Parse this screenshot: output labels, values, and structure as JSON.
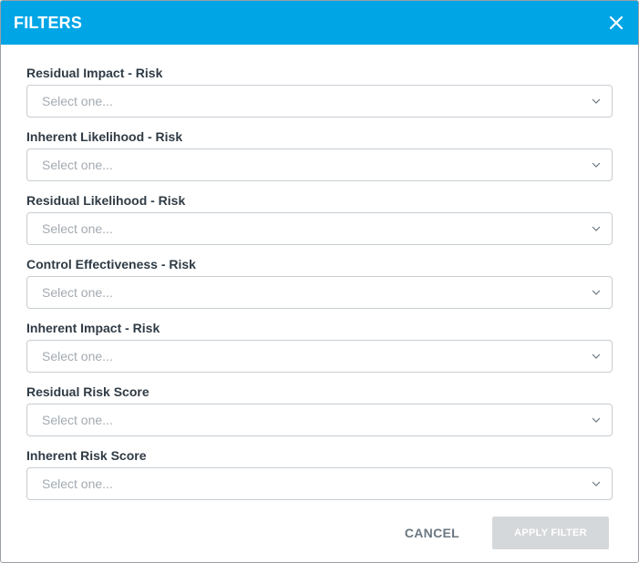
{
  "dialog": {
    "title": "FILTERS",
    "close_icon": "close-icon"
  },
  "fields": [
    {
      "label": "Residual Impact - Risk",
      "placeholder": "Select one..."
    },
    {
      "label": "Inherent Likelihood - Risk",
      "placeholder": "Select one..."
    },
    {
      "label": "Residual Likelihood - Risk",
      "placeholder": "Select one..."
    },
    {
      "label": "Control Effectiveness - Risk",
      "placeholder": "Select one..."
    },
    {
      "label": "Inherent Impact - Risk",
      "placeholder": "Select one..."
    },
    {
      "label": "Residual Risk Score",
      "placeholder": "Select one..."
    },
    {
      "label": "Inherent Risk Score",
      "placeholder": "Select one..."
    }
  ],
  "footer": {
    "cancel_label": "CANCEL",
    "apply_label": "APPLY FILTER",
    "apply_enabled": false
  },
  "colors": {
    "header_bg": "#00a5e6",
    "apply_disabled_bg": "#d5d8da"
  }
}
